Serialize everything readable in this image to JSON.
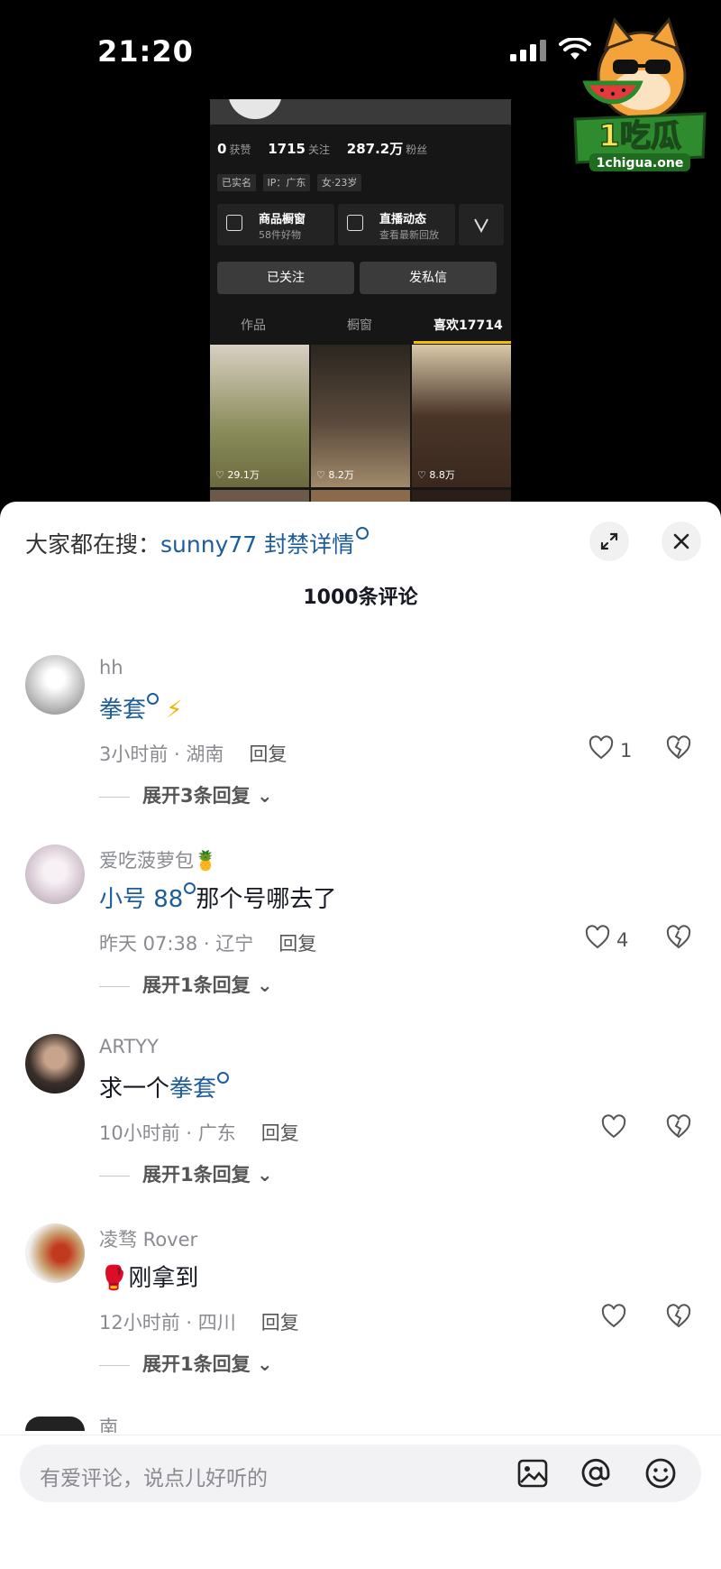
{
  "status_bar": {
    "time": "21:20"
  },
  "watermark": {
    "brand": "1吃瓜",
    "url": "1chigua.one"
  },
  "profile_shot": {
    "stats": [
      {
        "value": "0",
        "label": "获赞"
      },
      {
        "value": "1715",
        "label": "关注"
      },
      {
        "value": "287.2万",
        "label": "粉丝"
      }
    ],
    "tags": [
      "已实名",
      "IP：广东",
      "女·23岁"
    ],
    "cards": [
      {
        "title": "商品橱窗",
        "sub": "58件好物"
      },
      {
        "title": "直播动态",
        "sub": "查看最新回放"
      }
    ],
    "follow_button": "已关注",
    "message_button": "发私信",
    "tabs": [
      "作品",
      "橱窗",
      "喜欢17714"
    ],
    "photos": [
      {
        "likes": "29.1万",
        "color": "#8a8c5a"
      },
      {
        "likes": "8.2万",
        "color": "#5b4a3c"
      },
      {
        "likes": "8.8万",
        "color": "#4a3528"
      }
    ]
  },
  "sheet": {
    "search_prefix": "大家都在搜：",
    "search_keyword": "sunny77 封禁详情",
    "comment_count": "1000条评论",
    "comments": [
      {
        "user": "hh",
        "text_link": "拳套",
        "text_after": "⚡",
        "time_loc": "3小时前 · 湖南",
        "reply": "回复",
        "likes": "1",
        "expand": "展开3条回复",
        "avatar_color": "#d8d8d8"
      },
      {
        "user": "爱吃菠萝包🍍",
        "text_link": "小号 88",
        "text_after": "那个号哪去了",
        "time_loc": "昨天 07:38 · 辽宁",
        "reply": "回复",
        "likes": "4",
        "expand": "展开1条回复",
        "avatar_color": "#e8dfe6"
      },
      {
        "user": "ARTYY",
        "text_before": "求一个",
        "text_link": "拳套",
        "time_loc": "10小时前 · 广东",
        "reply": "回复",
        "likes": "",
        "expand": "展开1条回复",
        "avatar_color": "#3a2f2a"
      },
      {
        "user": "凌骛 Rover",
        "text_plain": "🥊刚拿到",
        "time_loc": "12小时前 · 四川",
        "reply": "回复",
        "likes": "",
        "expand": "展开1条回复",
        "avatar_color": "#c8a070"
      }
    ],
    "partial_user": "南毅",
    "input_placeholder": "有爱评论，说点儿好听的"
  }
}
